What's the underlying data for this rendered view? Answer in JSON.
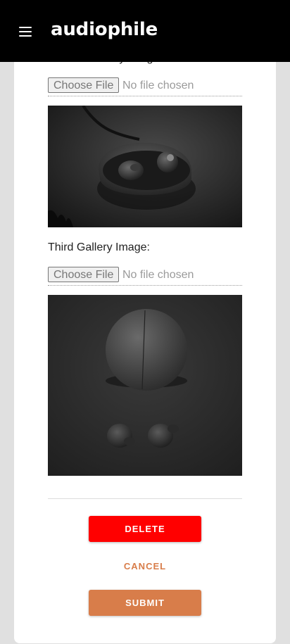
{
  "header": {
    "brand": "audiophile",
    "menu_icon": "hamburger-menu-icon",
    "background": "#000000"
  },
  "form": {
    "second_gallery": {
      "label_partial": "Second Gallery Image:",
      "file_button": "Choose File",
      "file_status": "No file chosen"
    },
    "third_gallery": {
      "label": "Third Gallery Image:",
      "file_button": "Choose File",
      "file_status": "No file chosen"
    }
  },
  "actions": {
    "delete": "DELETE",
    "cancel": "CANCEL",
    "submit": "SUBMIT"
  },
  "colors": {
    "accent": "#d87d4a",
    "danger": "#ff0000",
    "page_bg": "#e0e0e0"
  }
}
